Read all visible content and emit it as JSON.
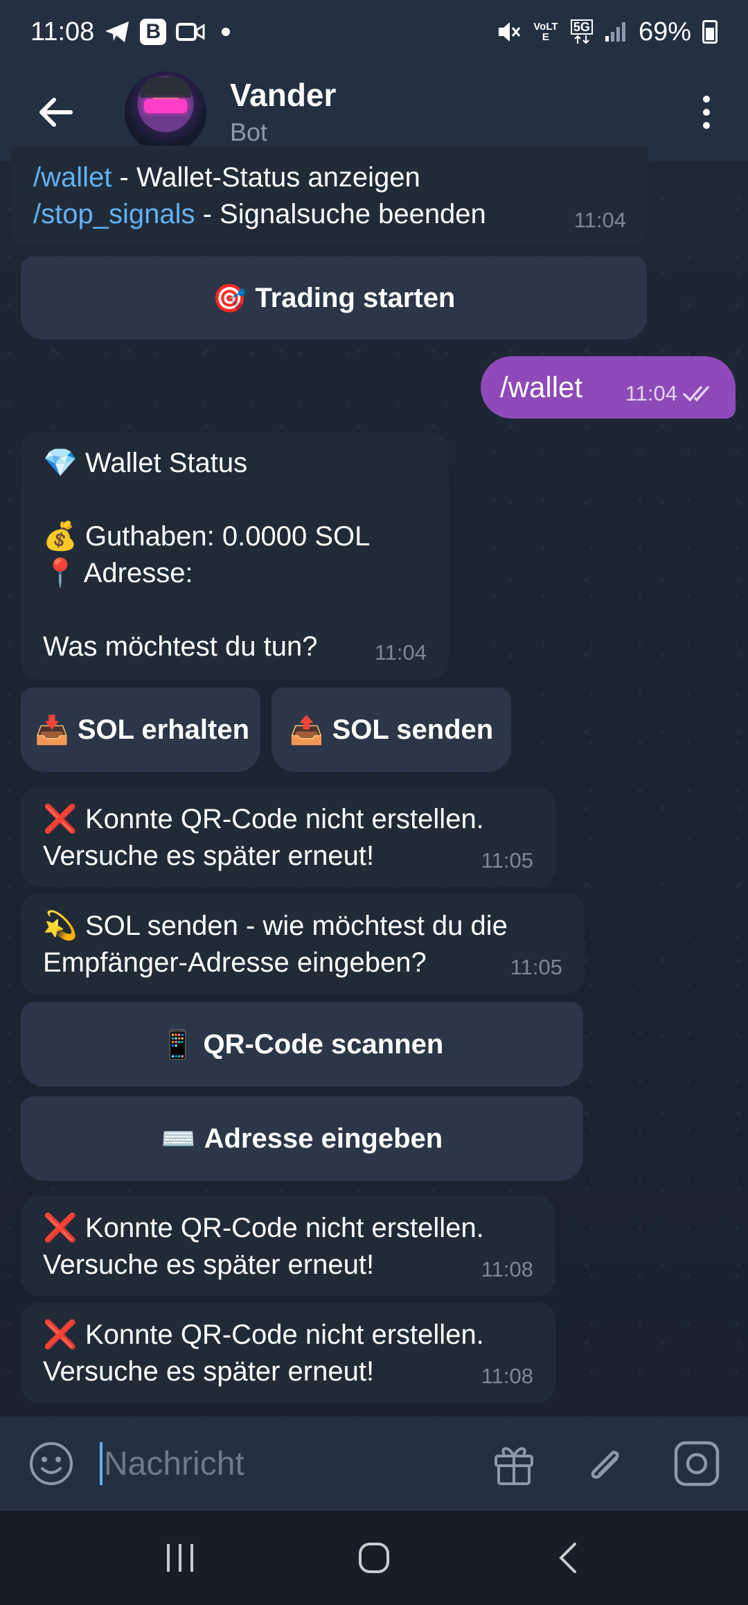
{
  "status_bar": {
    "time": "11:08",
    "b_badge": "B",
    "signal_lte": "VoLTE",
    "network": "5G",
    "battery": "69%"
  },
  "header": {
    "title": "Vander",
    "subtitle": "Bot"
  },
  "messages": {
    "m1": {
      "cmd1": "/wallet",
      "cmd1_desc": " - Wallet-Status anzeigen",
      "cmd2": "/stop_signals",
      "cmd2_desc": " - Signalsuche beenden",
      "time": "11:04"
    },
    "btn_trading": {
      "emoji": "🎯",
      "label": "Trading starten"
    },
    "out1": {
      "text": "/wallet",
      "time": "11:04"
    },
    "m2": {
      "line1_emoji": "💎",
      "line1": "Wallet Status",
      "line2_emoji": "💰",
      "line2": "Guthaben: 0.0000 SOL",
      "line3_emoji": "📍",
      "line3": "Adresse:",
      "line4": "Was möchtest du tun?",
      "time": "11:04"
    },
    "btn_receive": {
      "emoji": "📥",
      "label": "SOL erhalten"
    },
    "btn_send": {
      "emoji": "📤",
      "label": "SOL senden"
    },
    "m3": {
      "emoji": "❌",
      "line1": "Konnte QR-Code nicht erstellen.",
      "line2": "Versuche es später erneut!",
      "time": "11:05"
    },
    "m4": {
      "emoji": "💫",
      "line1": "SOL senden - wie möchtest du die",
      "line2": "Empfänger-Adresse eingeben?",
      "time": "11:05"
    },
    "btn_scan": {
      "emoji": "📱",
      "label": "QR-Code scannen"
    },
    "btn_enter": {
      "emoji": "⌨️",
      "label": "Adresse eingeben"
    },
    "m5": {
      "emoji": "❌",
      "line1": "Konnte QR-Code nicht erstellen.",
      "line2": "Versuche es später erneut!",
      "time": "11:08"
    },
    "m6": {
      "emoji": "❌",
      "line1": "Konnte QR-Code nicht erstellen.",
      "line2": "Versuche es später erneut!",
      "time": "11:08"
    }
  },
  "input": {
    "placeholder": "Nachricht"
  },
  "colors": {
    "header_bg": "#233042",
    "bubble_in": "#212b38",
    "bubble_out": "#8e4ab8",
    "button_bg": "#2b3748",
    "link": "#62b3f5"
  }
}
